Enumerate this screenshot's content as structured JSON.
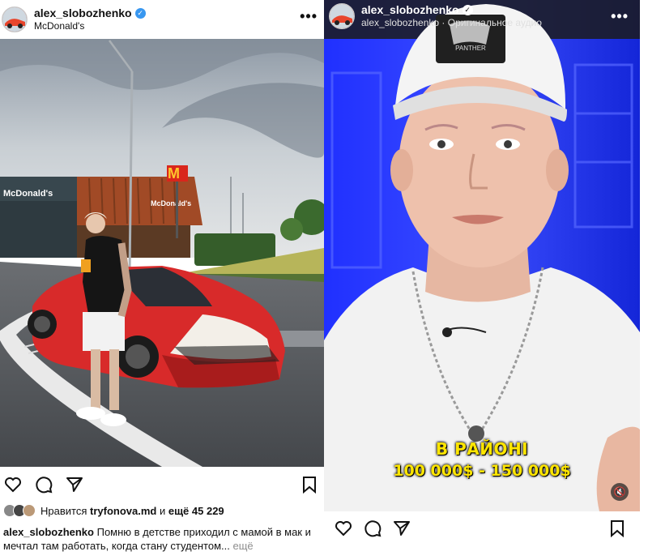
{
  "left_post": {
    "username": "alex_slobozhenko",
    "location": "McDonald's",
    "menu_label": "•••",
    "sign_mcdonalds": "McDonald's",
    "sign_mcdonalds_2": "McDonald's",
    "likes_prefix": "Нравится",
    "likes_user": "tryfonova.md",
    "likes_and": "и",
    "likes_count": "ещё 45 229",
    "caption_user": "alex_slobozhenko",
    "caption_text": "Помню в детстве приходил с мамой в мак и мечтал там работать, когда стану студентом...",
    "caption_more": "ещё"
  },
  "right_post": {
    "username": "alex_slobozhenko",
    "audio": "alex_slobozhenko · Оригинальное аудио",
    "menu_label": "•••",
    "cap_logo_text": "PANTHER",
    "subtitle_line1": "В РАЙОНІ",
    "subtitle_line2": "100 000$ - 150 000$",
    "mute_icon": "speaker-muted"
  },
  "colors": {
    "verified": "#3897f0",
    "subtitle": "#ffe600",
    "car": "#e02a2a",
    "video_bg": "#1a2dff"
  }
}
